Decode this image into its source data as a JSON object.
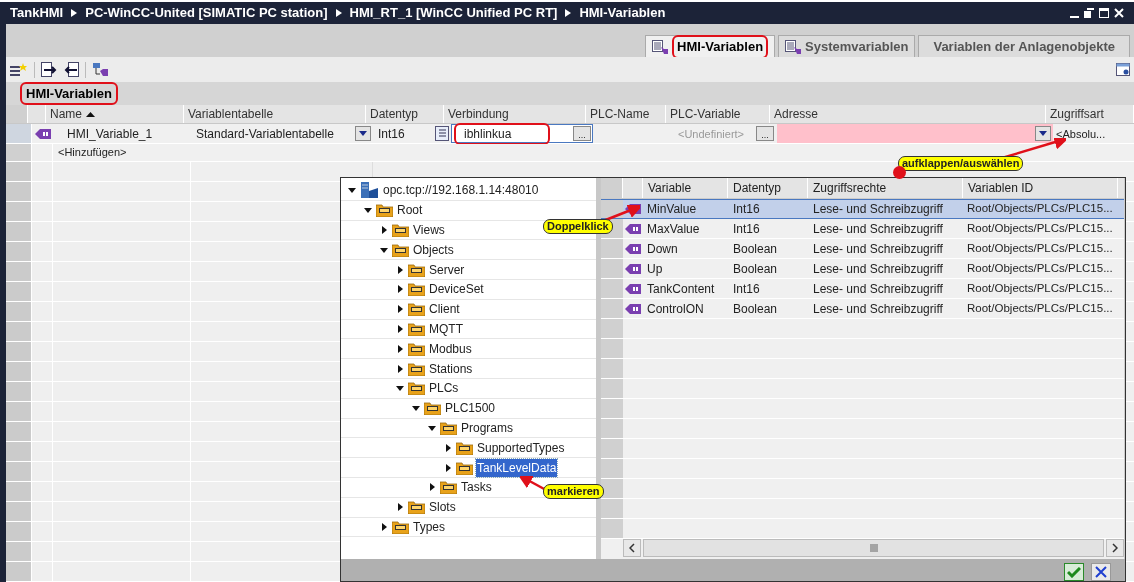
{
  "window": {
    "breadcrumb": [
      "TankHMI",
      "PC-WinCC-United [SIMATIC PC station]",
      "HMI_RT_1 [WinCC Unified PC RT]",
      "HMI-Variablen"
    ]
  },
  "tabs": [
    {
      "label": "HMI-Variablen",
      "selected": true,
      "icon": true,
      "highlighted": true
    },
    {
      "label": "Systemvariablen",
      "selected": false,
      "icon": true,
      "highlighted": false
    },
    {
      "label": "Variablen der Anlagenobjekte",
      "selected": false,
      "icon": false,
      "highlighted": false
    }
  ],
  "section": {
    "title": "HMI-Variablen",
    "highlighted": true
  },
  "table": {
    "columns": [
      {
        "label": "Name",
        "sorted": true
      },
      {
        "label": "Variablentabelle",
        "sorted": false
      },
      {
        "label": "Datentyp",
        "sorted": false
      },
      {
        "label": "Verbindung",
        "sorted": false
      },
      {
        "label": "PLC-Name",
        "sorted": false
      },
      {
        "label": "PLC-Variable",
        "sorted": false
      },
      {
        "label": "Adresse",
        "sorted": false
      },
      {
        "label": "Zugriffsart",
        "sorted": false
      }
    ],
    "rows": [
      {
        "name": "HMI_Variable_1",
        "table": "Standard-Variablentabelle",
        "datatype": "Int16",
        "connection": {
          "value": "ibhlinkua",
          "highlighted": true,
          "browse": "..."
        },
        "plc_name": "",
        "plc_variable": {
          "value": "<Undefiniert>",
          "browse": "..."
        },
        "address": {
          "error": true
        },
        "access": "<Absolu..."
      }
    ],
    "add_row": "<Hinzufügen>"
  },
  "browser": {
    "tree": [
      {
        "label": "opc.tcp://192.168.1.14:48010",
        "kind": "server",
        "expanded": true,
        "selected": false,
        "children": [
          {
            "label": "Root",
            "kind": "folder",
            "expanded": true,
            "selected": false,
            "children": [
              {
                "label": "Views",
                "kind": "folder",
                "expanded": false,
                "selected": false
              },
              {
                "label": "Objects",
                "kind": "folder",
                "expanded": true,
                "selected": false,
                "children": [
                  {
                    "label": "Server",
                    "kind": "folder",
                    "expanded": false,
                    "selected": false
                  },
                  {
                    "label": "DeviceSet",
                    "kind": "folder",
                    "expanded": false,
                    "selected": false
                  },
                  {
                    "label": "Client",
                    "kind": "folder",
                    "expanded": false,
                    "selected": false
                  },
                  {
                    "label": "MQTT",
                    "kind": "folder",
                    "expanded": false,
                    "selected": false
                  },
                  {
                    "label": "Modbus",
                    "kind": "folder",
                    "expanded": false,
                    "selected": false
                  },
                  {
                    "label": "Stations",
                    "kind": "folder",
                    "expanded": false,
                    "selected": false
                  },
                  {
                    "label": "PLCs",
                    "kind": "folder",
                    "expanded": true,
                    "selected": false,
                    "children": [
                      {
                        "label": "PLC1500",
                        "kind": "folder",
                        "expanded": true,
                        "selected": false,
                        "children": [
                          {
                            "label": "Programs",
                            "kind": "folder",
                            "expanded": true,
                            "selected": false,
                            "children": [
                              {
                                "label": "SupportedTypes",
                                "kind": "folder",
                                "expanded": false,
                                "selected": false
                              },
                              {
                                "label": "TankLevelData",
                                "kind": "folder",
                                "expanded": false,
                                "selected": true
                              }
                            ]
                          },
                          {
                            "label": "Tasks",
                            "kind": "folder",
                            "expanded": false,
                            "selected": false
                          }
                        ]
                      }
                    ]
                  },
                  {
                    "label": "Slots",
                    "kind": "folder",
                    "expanded": false,
                    "selected": false
                  }
                ]
              },
              {
                "label": "Types",
                "kind": "folder",
                "expanded": false,
                "selected": false
              }
            ]
          }
        ]
      }
    ],
    "columns": [
      "Variable",
      "Datentyp",
      "Zugriffsrechte",
      "Variablen ID"
    ],
    "rows": [
      {
        "variable": "MinValue",
        "datatype": "Int16",
        "access": "Lese- und Schreibzugriff",
        "id": "Root/Objects/PLCs/PLC15...",
        "selected": true
      },
      {
        "variable": "MaxValue",
        "datatype": "Int16",
        "access": "Lese- und Schreibzugriff",
        "id": "Root/Objects/PLCs/PLC15...",
        "selected": false
      },
      {
        "variable": "Down",
        "datatype": "Boolean",
        "access": "Lese- und Schreibzugriff",
        "id": "Root/Objects/PLCs/PLC15...",
        "selected": false
      },
      {
        "variable": "Up",
        "datatype": "Boolean",
        "access": "Lese- und Schreibzugriff",
        "id": "Root/Objects/PLCs/PLC15...",
        "selected": false
      },
      {
        "variable": "TankContent",
        "datatype": "Int16",
        "access": "Lese- und Schreibzugriff",
        "id": "Root/Objects/PLCs/PLC15...",
        "selected": false
      },
      {
        "variable": "ControlON",
        "datatype": "Boolean",
        "access": "Lese- und Schreibzugriff",
        "id": "Root/Objects/PLCs/PLC15...",
        "selected": false
      }
    ]
  },
  "callouts": [
    {
      "text": "aufklappen/auswählen"
    },
    {
      "text": "Doppelklick"
    },
    {
      "text": "markieren"
    }
  ]
}
